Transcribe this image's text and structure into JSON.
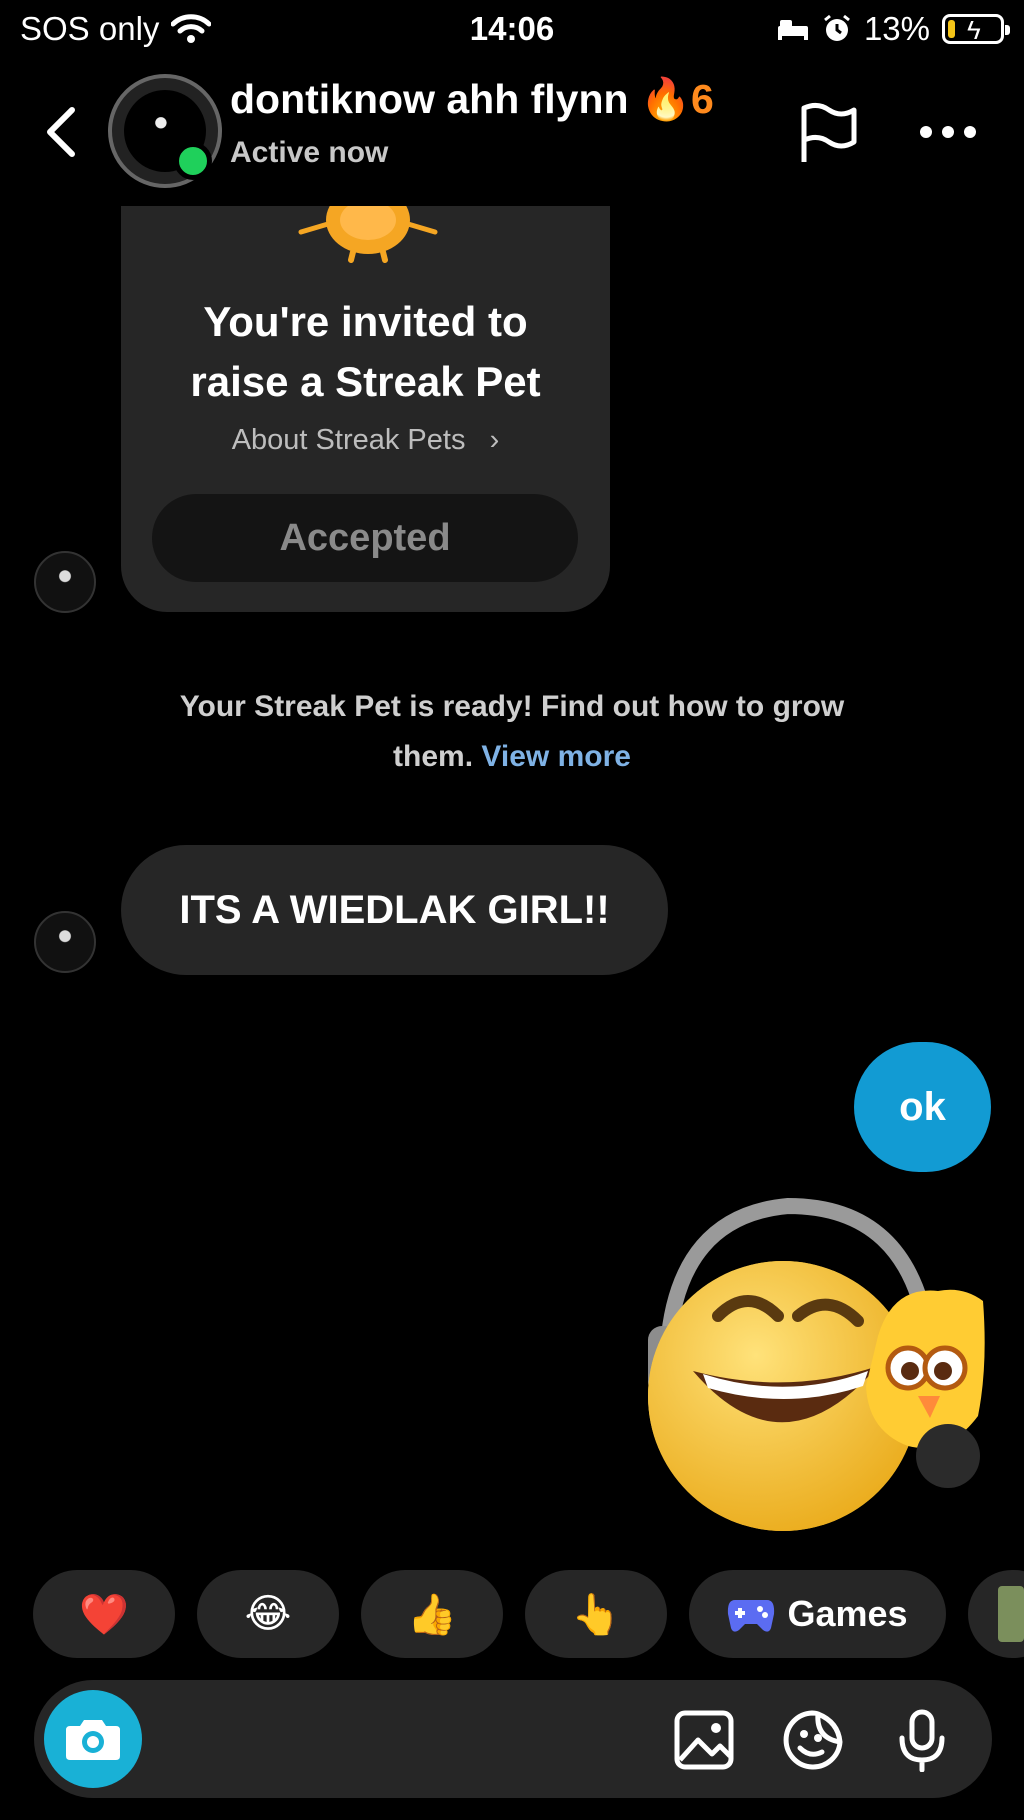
{
  "status_bar": {
    "carrier": "SOS only",
    "time": "14:06",
    "battery": "13%",
    "battery_level": 0.13
  },
  "header": {
    "name": "dontiknow ahh flynn",
    "streak_count": "6",
    "status": "Active now"
  },
  "invite_card": {
    "title_line1": "You're invited to",
    "title_line2": "raise a Streak Pet",
    "about_link": "About Streak Pets",
    "button_label": "Accepted"
  },
  "system_message": {
    "text_line1": "Your Streak Pet is ready! Find out how to grow",
    "text_line2": "them.",
    "link": "View more"
  },
  "messages": {
    "incoming": "ITS A WIEDLAK GIRL!!",
    "outgoing": "ok"
  },
  "quick_replies": {
    "heart": "❤️",
    "laugh": "😂",
    "thumbs_up": "👍",
    "point": "👆",
    "games_label": "Games"
  },
  "composer": {
    "placeholder": ""
  },
  "colors": {
    "online": "#1fd05b",
    "outgoing_bubble": "#129bd3",
    "link": "#7fb2e5",
    "camera": "#19b1d6",
    "streak": "#ff8a1d"
  }
}
